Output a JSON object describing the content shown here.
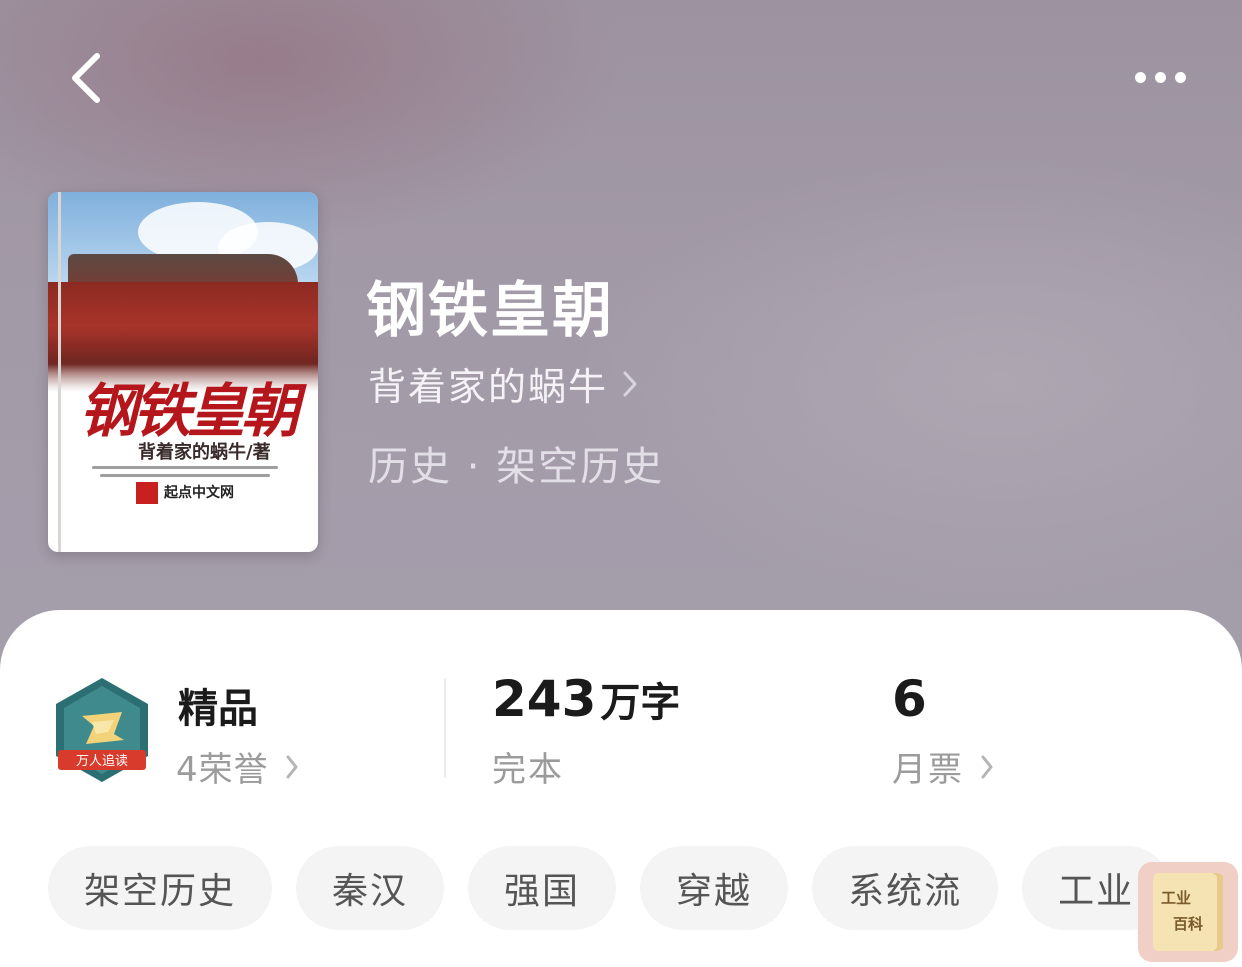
{
  "nav": {
    "back_icon": "chevron-left-icon",
    "more_icon": "more-dots-icon"
  },
  "book": {
    "title": "钢铁皇朝",
    "author": "背着家的蜗牛",
    "genre": "历史 · 架空历史",
    "cover": {
      "title": "钢铁皇朝",
      "author": "背着家的蜗牛/著",
      "publisher": "起点中文网"
    }
  },
  "stats": {
    "badge": {
      "icon": "honor-badge-icon",
      "label": "万人追读"
    },
    "quality_label": "精品",
    "honors": "4荣誉",
    "word_count": "243",
    "word_unit": "万字",
    "status": "完本",
    "monthly_tickets": "6",
    "monthly_tickets_label": "月票"
  },
  "tags": [
    "架空历史",
    "秦汉",
    "强国",
    "穿越",
    "系统流",
    "工业"
  ],
  "watermark": {
    "line1": "工业",
    "line2": "百科"
  },
  "colors": {
    "hero_background": "#a39aa8",
    "panel_background": "#ffffff",
    "tag_background": "#f4f4f4",
    "secondary_text": "#9b9b9b",
    "primary_text": "#1b1b1b"
  }
}
